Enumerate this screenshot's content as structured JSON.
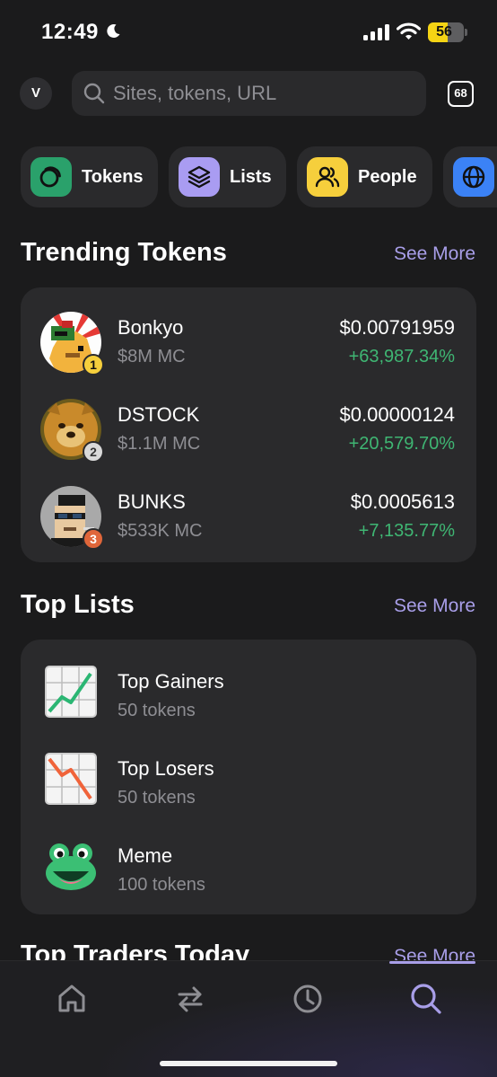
{
  "status": {
    "time": "12:49",
    "battery": "56",
    "battery_level": 0.56
  },
  "search": {
    "avatar_initial": "V",
    "placeholder": "Sites, tokens, URL",
    "tab_count": "68"
  },
  "chips": [
    {
      "label": "Tokens",
      "icon": "tokens-icon",
      "color": "#2aa16b"
    },
    {
      "label": "Lists",
      "icon": "layers-icon",
      "color": "#a99cf2"
    },
    {
      "label": "People",
      "icon": "people-icon",
      "color": "#f6cf3c"
    },
    {
      "label": "",
      "icon": "globe-icon",
      "color": "#3b82f6"
    }
  ],
  "trending": {
    "title": "Trending Tokens",
    "see_more": "See More",
    "tokens": [
      {
        "rank": "1",
        "name": "Bonkyo",
        "mc": "$8M MC",
        "price": "$0.00791959",
        "change": "+63,987.34%"
      },
      {
        "rank": "2",
        "name": "DSTOCK",
        "mc": "$1.1M MC",
        "price": "$0.00000124",
        "change": "+20,579.70%"
      },
      {
        "rank": "3",
        "name": "BUNKS",
        "mc": "$533K MC",
        "price": "$0.0005613",
        "change": "+7,135.77%"
      }
    ]
  },
  "top_lists": {
    "title": "Top Lists",
    "see_more": "See More",
    "lists": [
      {
        "title": "Top Gainers",
        "sub": "50 tokens",
        "icon": "chart-up-icon"
      },
      {
        "title": "Top Losers",
        "sub": "50 tokens",
        "icon": "chart-down-icon"
      },
      {
        "title": "Meme",
        "sub": "100 tokens",
        "icon": "frog-icon"
      }
    ]
  },
  "top_traders": {
    "title": "Top Traders Today",
    "see_more": "See More"
  },
  "nav": [
    "home-icon",
    "swap-icon",
    "history-icon",
    "search-icon"
  ],
  "colors": {
    "accent": "#a89ee8",
    "positive": "#3fb673",
    "background": "#1b1b1c",
    "card": "#2a2a2c"
  }
}
